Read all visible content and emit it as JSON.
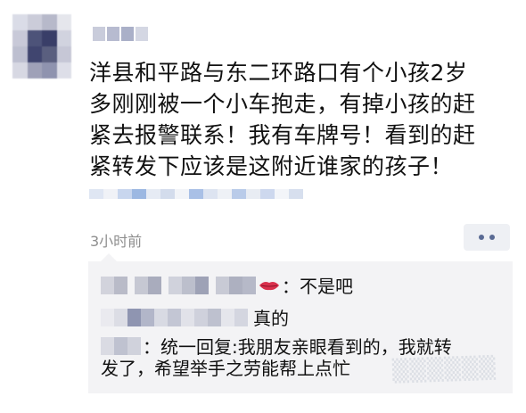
{
  "post": {
    "lines": [
      "洋县和平路与东二环路口有个小孩2岁",
      "多刚刚被一个小车抱走，有掉小孩的赶",
      "紧去报警联系！我有车牌号！看到的赶",
      "紧转发下应该是这附近谁家的孩子！"
    ],
    "timestamp": "3小时前"
  },
  "comments": [
    {
      "text": "：不是吧"
    },
    {
      "text": "真的"
    },
    {
      "text": "：统一回复:我朋友亲眼看到的，我就转"
    }
  ],
  "reply_continued": "发了，希望举手之劳能帮上点忙",
  "colors": {
    "link_blue": "#5a6b94",
    "comment_bg": "#f3f3f5",
    "timestamp_gray": "#8e8e8e",
    "lips_red": "#d9304c"
  },
  "icons": {
    "more": "more-dots-icon",
    "lips": "lips-icon"
  }
}
